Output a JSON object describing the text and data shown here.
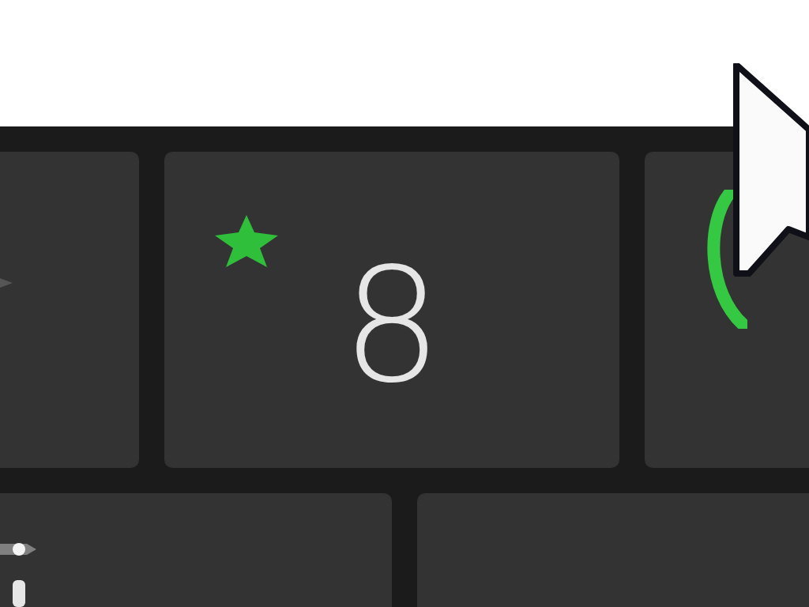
{
  "keyboard": {
    "rows": [
      {
        "keys": [
          {
            "kind": "arrow"
          },
          {
            "kind": "digit",
            "label": "8",
            "starred": true
          },
          {
            "kind": "arc"
          }
        ]
      },
      {
        "keys": [
          {
            "kind": "slider"
          },
          {
            "kind": "blank"
          }
        ]
      }
    ]
  }
}
